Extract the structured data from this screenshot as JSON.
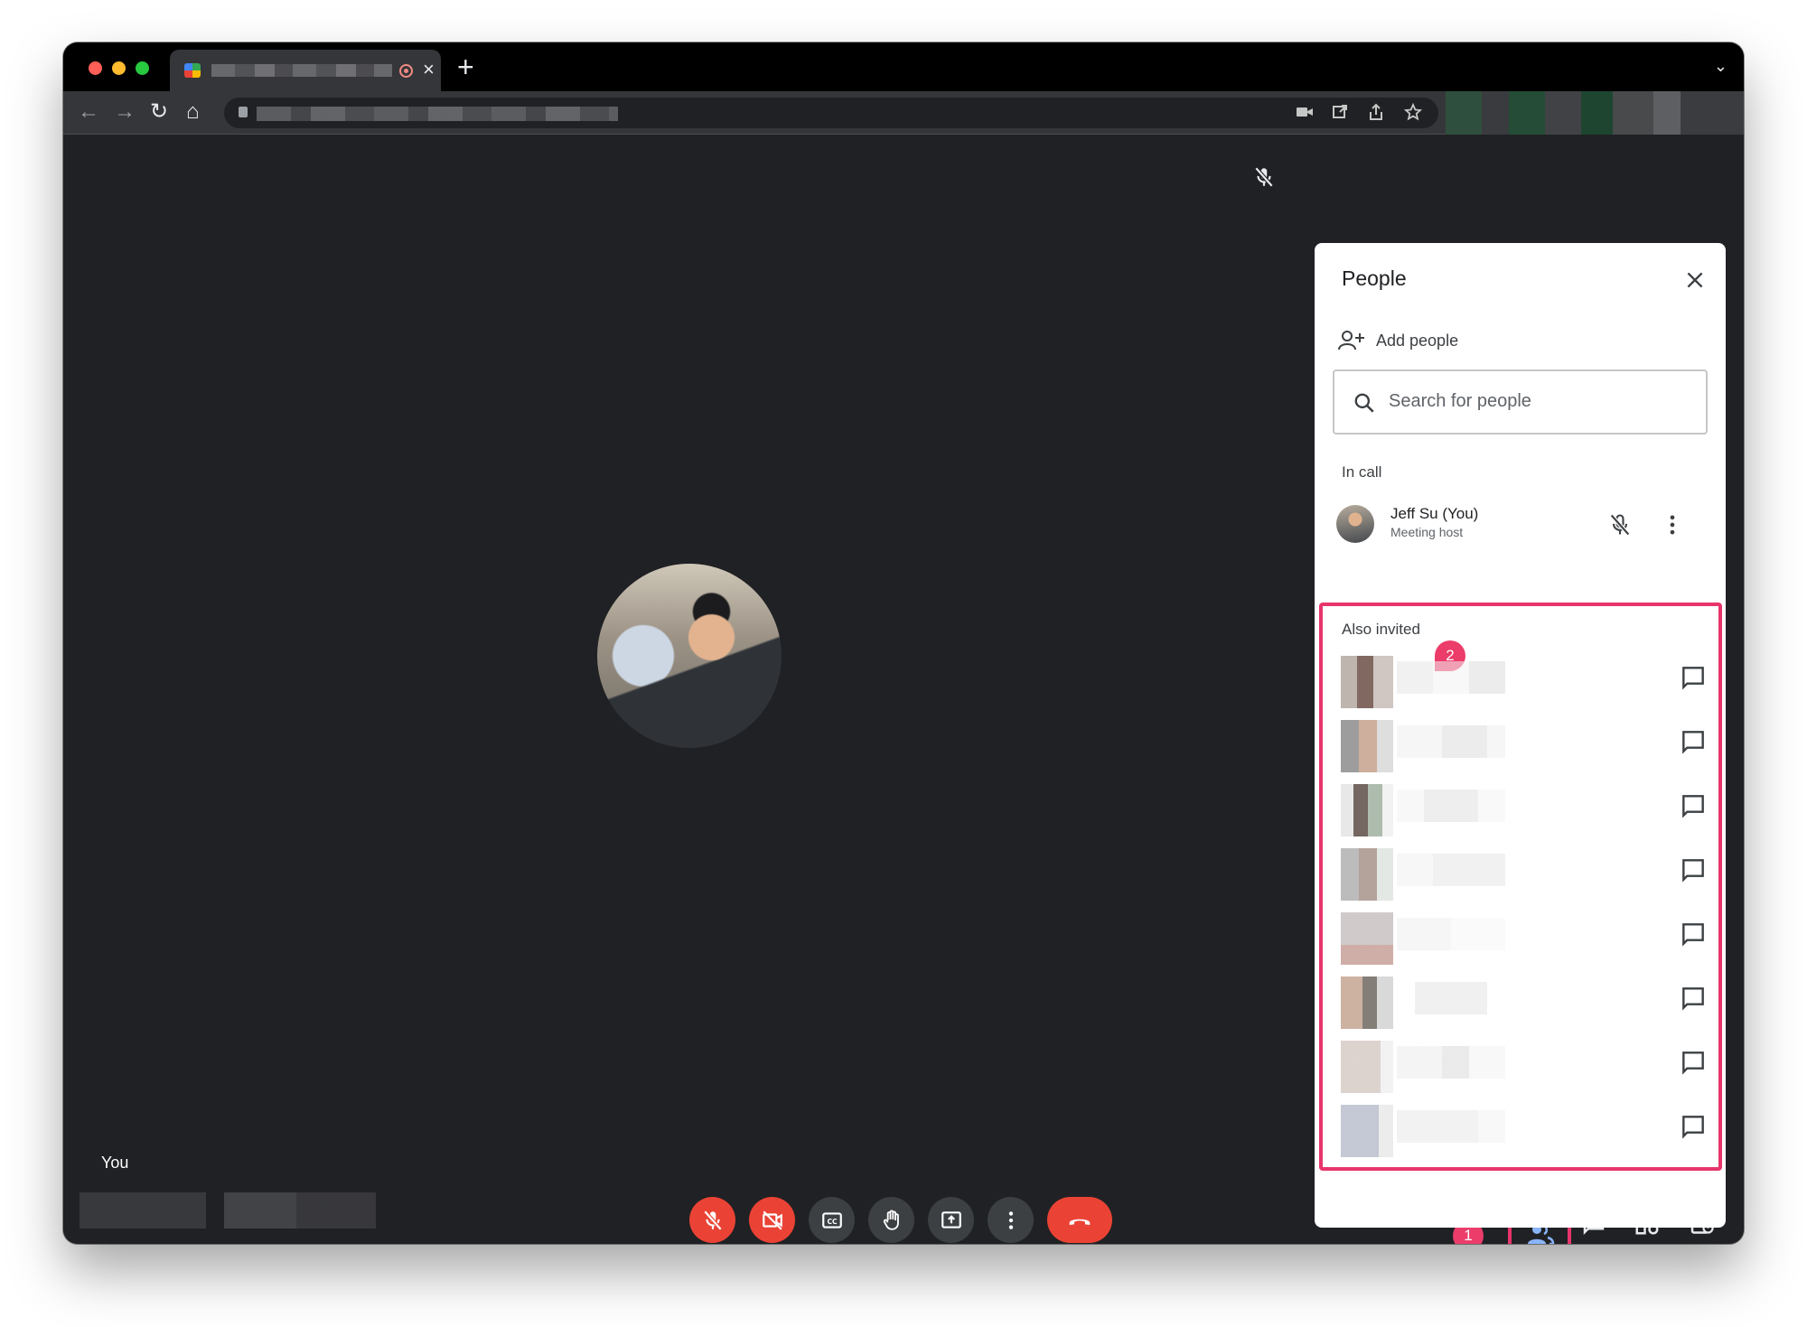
{
  "browser": {
    "tab_close": "×",
    "new_tab": "+",
    "tab_menu": "⌄"
  },
  "meeting": {
    "self_label": "You"
  },
  "people_panel": {
    "title": "People",
    "add_people_label": "Add people",
    "search_placeholder": "Search for people",
    "in_call_label": "In call",
    "participant": {
      "name": "Jeff Su (You)",
      "role": "Meeting host"
    },
    "also_invited_label": "Also invited",
    "invited_count_rows": 8,
    "participants_badge": "1"
  },
  "annotations": {
    "callout_1": "1",
    "callout_2": "2"
  },
  "colors": {
    "accent_red": "#ea4335",
    "highlight_pink": "#e7356b",
    "people_active_blue": "#8ab4f8",
    "stage_bg": "#202124"
  },
  "controls": [
    {
      "name": "mic-off-button",
      "icon": "mic-off-icon"
    },
    {
      "name": "camera-off-button",
      "icon": "videocam-off-icon"
    },
    {
      "name": "captions-button",
      "icon": "closed-captions-icon"
    },
    {
      "name": "raise-hand-button",
      "icon": "hand-icon"
    },
    {
      "name": "present-button",
      "icon": "present-screen-icon"
    },
    {
      "name": "more-options-button",
      "icon": "more-vert-icon"
    },
    {
      "name": "leave-call-button",
      "icon": "call-end-icon"
    }
  ]
}
